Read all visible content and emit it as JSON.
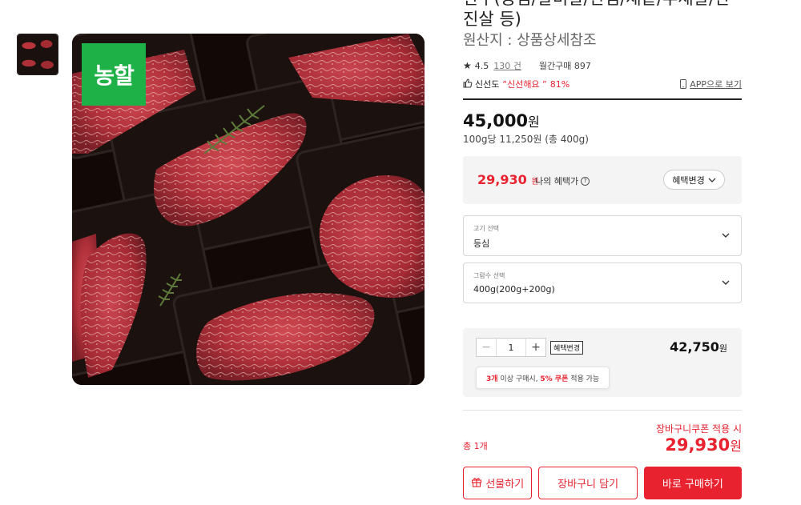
{
  "product": {
    "title_partial": "한우(등심/갈비살/안심/채끝/부채살/안",
    "title_line2": "진살 등)",
    "origin": "원산지 : 상품상세참조",
    "badge": "농할"
  },
  "rating": {
    "score": "4.5",
    "review_count": "130 건",
    "monthly_purchase": "월간구매 897"
  },
  "freshness": {
    "label": "신선도",
    "quote": "“신선해요 ”",
    "percent": "81%",
    "app_link": "APP으로 보기"
  },
  "pricing": {
    "price": "45,000",
    "won": "원",
    "unit_price": "100g당 11,250원 (총 400g)",
    "benefit_price": "29,930",
    "benefit_won": "원",
    "benefit_label": "나의 혜택가",
    "benefit_change": "혜택변경"
  },
  "options": [
    {
      "label": "고기 선택",
      "value": "등심"
    },
    {
      "label": "그람수 선택",
      "value": "400g(200g+200g)"
    }
  ],
  "quantity": {
    "value": "1",
    "minus": "−",
    "plus": "+",
    "badge": "혜택변경",
    "item_price": "42,750",
    "won": "원",
    "coupon_tip_a": "3개",
    "coupon_tip_b": " 이상 구매시, ",
    "coupon_tip_c": "5% 쿠폰",
    "coupon_tip_d": " 적용 가능"
  },
  "summary": {
    "cart_coupon": "장바구니쿠폰 적용 시",
    "total_label": "총 1개",
    "total_price": "29,930",
    "won": "원"
  },
  "actions": {
    "gift": "선물하기",
    "cart": "장바구니 담기",
    "buy": "바로 구매하기"
  },
  "colors": {
    "accent": "#e8222f",
    "badge_green": "#1db148"
  }
}
